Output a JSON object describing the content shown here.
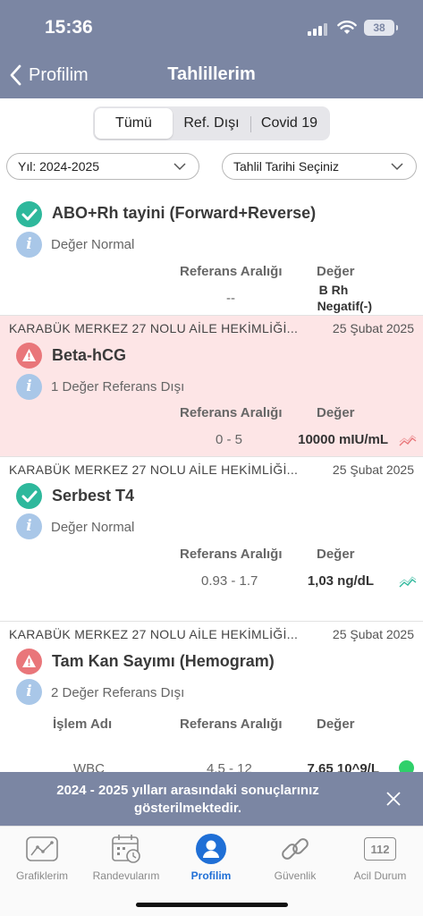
{
  "status_bar": {
    "time": "15:36",
    "battery": "38"
  },
  "nav": {
    "back_label": "Profilim",
    "title": "Tahlillerim"
  },
  "segments": [
    {
      "label": "Tümü",
      "active": true
    },
    {
      "label": "Ref. Dışı",
      "active": false
    },
    {
      "label": "Covid 19",
      "active": false
    }
  ],
  "filters": {
    "year": "Yıl: 2024-2025",
    "date": "Tahlil Tarihi Seçiniz"
  },
  "headers": {
    "range": "Referans Aralığı",
    "value": "Değer",
    "name": "İşlem Adı"
  },
  "results": [
    {
      "lab": "",
      "date": "",
      "test": "ABO+Rh tayini (Forward+Reverse)",
      "status": "ok",
      "summary": "Değer Normal",
      "range": "--",
      "value_line1": "B Rh",
      "value_line2": "Negatif(-)"
    },
    {
      "lab": "KARABÜK MERKEZ 27 NOLU AİLE HEKİMLİĞİ...",
      "date": "25 Şubat 2025",
      "test": "Beta-hCG",
      "status": "alert",
      "summary": "1 Değer Referans Dışı",
      "range": "0 - 5",
      "value": "10000 mIU/mL"
    },
    {
      "lab": "KARABÜK MERKEZ 27 NOLU AİLE HEKİMLİĞİ...",
      "date": "25 Şubat 2025",
      "test": "Serbest T4",
      "status": "ok",
      "summary": "Değer Normal",
      "range": "0.93 - 1.7",
      "value": "1,03 ng/dL"
    },
    {
      "lab": "KARABÜK MERKEZ 27 NOLU AİLE HEKİMLİĞİ...",
      "date": "25 Şubat 2025",
      "test": "Tam Kan Sayımı (Hemogram)",
      "status": "warn",
      "summary": "2 Değer Referans Dışı",
      "rows": [
        {
          "name": "WBC",
          "range": "4.5 - 12",
          "value": "7.65 10^9/L"
        }
      ]
    }
  ],
  "toast": {
    "message": "2024 - 2025 yılları arasındaki sonuçlarınız gösterilmektedir."
  },
  "tabbar": [
    {
      "label": "Grafiklerim",
      "icon": "chart-icon"
    },
    {
      "label": "Randevularım",
      "icon": "calendar-icon"
    },
    {
      "label": "Profilim",
      "icon": "profile-icon",
      "active": true
    },
    {
      "label": "Güvenlik",
      "icon": "link-icon"
    },
    {
      "label": "Acil Durum",
      "icon": "emergency-112-icon",
      "badge": "112"
    }
  ],
  "colors": {
    "header": "#7b86a3",
    "ok": "#2eb89c",
    "alert": "#e9767a",
    "alert_bg": "#fde5e6",
    "active_tab": "#1f6fd6"
  }
}
